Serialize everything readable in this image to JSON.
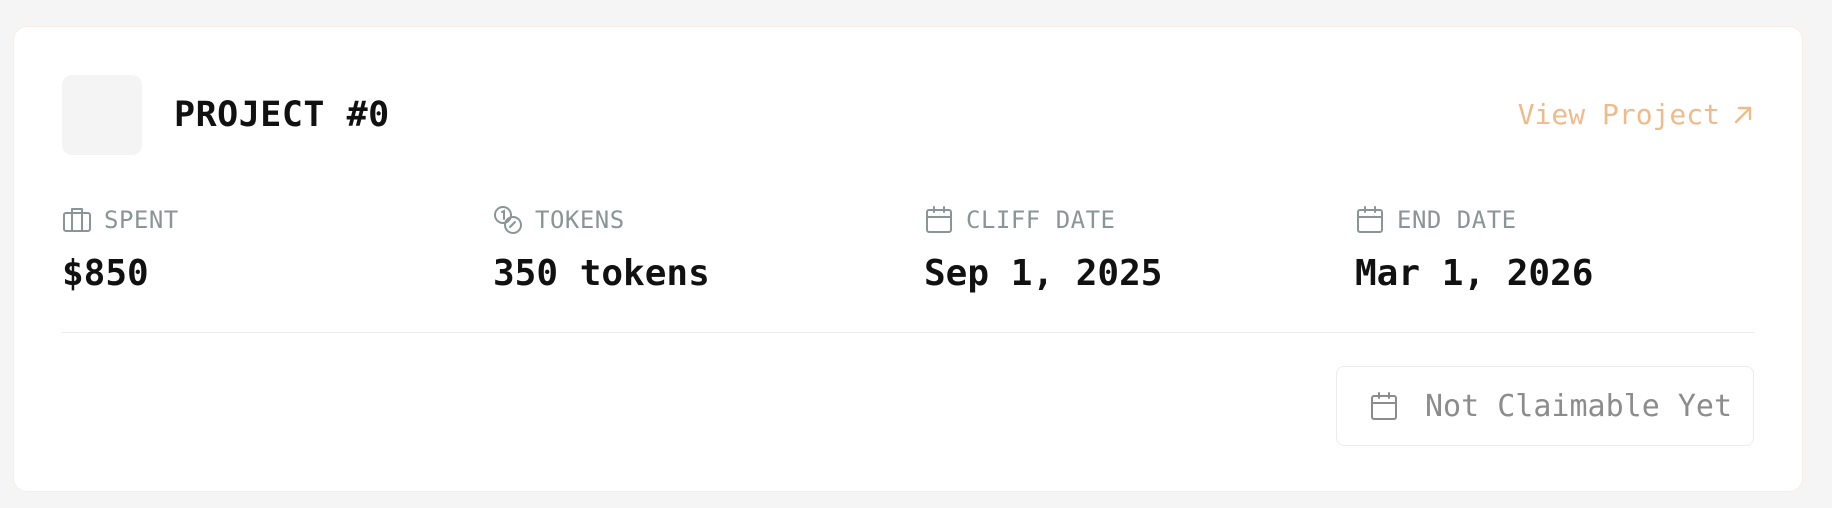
{
  "project": {
    "title": "PROJECT #0",
    "view_label": "View Project",
    "logo": "project-logo-placeholder"
  },
  "stats": [
    {
      "label": "SPENT",
      "value": "$850",
      "icon": "briefcase-icon"
    },
    {
      "label": "TOKENS",
      "value": "350 tokens",
      "icon": "coins-icon"
    },
    {
      "label": "CLIFF DATE",
      "value": "Sep 1, 2025",
      "icon": "calendar-icon"
    },
    {
      "label": "END DATE",
      "value": "Mar 1, 2026",
      "icon": "calendar-icon"
    }
  ],
  "claim": {
    "label": "Not Claimable Yet",
    "icon": "calendar-icon",
    "disabled": true
  },
  "colors": {
    "accent": "#f0bb8a",
    "muted": "#8a9595",
    "text": "#111111",
    "background": "#f5f5f5"
  }
}
